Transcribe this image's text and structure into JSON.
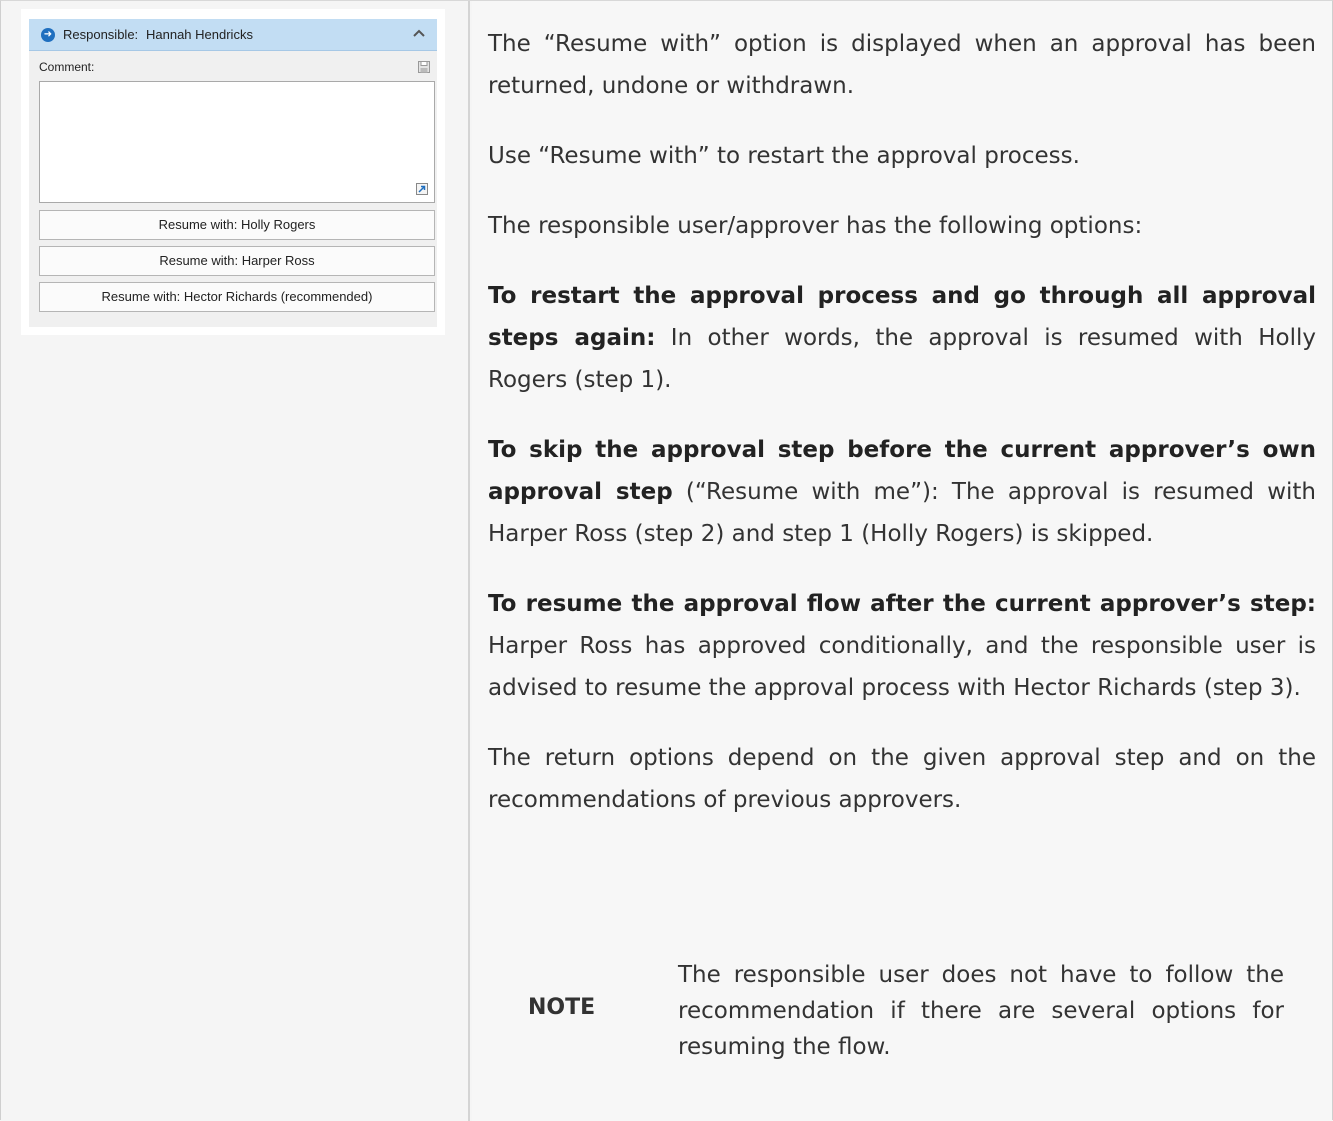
{
  "panel": {
    "responsible_label": "Responsible:",
    "responsible_name": "Hannah Hendricks",
    "comment_label": "Comment:",
    "buttons": [
      "Resume with: Holly Rogers",
      "Resume with: Harper Ross",
      "Resume with: Hector Richards (recommended)"
    ],
    "icons": [
      "arrow-right-circle-icon",
      "chevron-up-icon",
      "save-icon",
      "expand-icon"
    ],
    "colors": {
      "header_bg": "#c2ddf3",
      "icon_blue": "#1f6fbf"
    }
  },
  "content": {
    "p1": "The “Resume with” option is displayed when an approval has been returned, undone or withdrawn.",
    "p2": "Use “Resume with” to restart the approval process.",
    "p3": "The responsible user/approver has the following options:",
    "opt1_bold": "To restart the approval process and go through all approval steps again:",
    "opt1_text": " In other words, the approval is resumed with Holly Rogers (step 1).",
    "opt2_bold": "To skip the approval step before the current approver’s own approval step",
    "opt2_text": " (“Resume with me”): The approval is resumed with Harper Ross (step 2) and step 1 (Holly Rogers) is skipped.",
    "opt3_bold": "To resume the approval flow after the current approver’s step:",
    "opt3_text": " Harper Ross has approved conditionally, and the responsible user is advised to resume the approval process with Hector Richards (step 3).",
    "p4": "The return options depend on the given approval step and on the recommendations of previous approvers.",
    "note_label": "NOTE",
    "note_text": "The responsible user does not have to follow the recommendation if there are several options for resuming the flow."
  }
}
